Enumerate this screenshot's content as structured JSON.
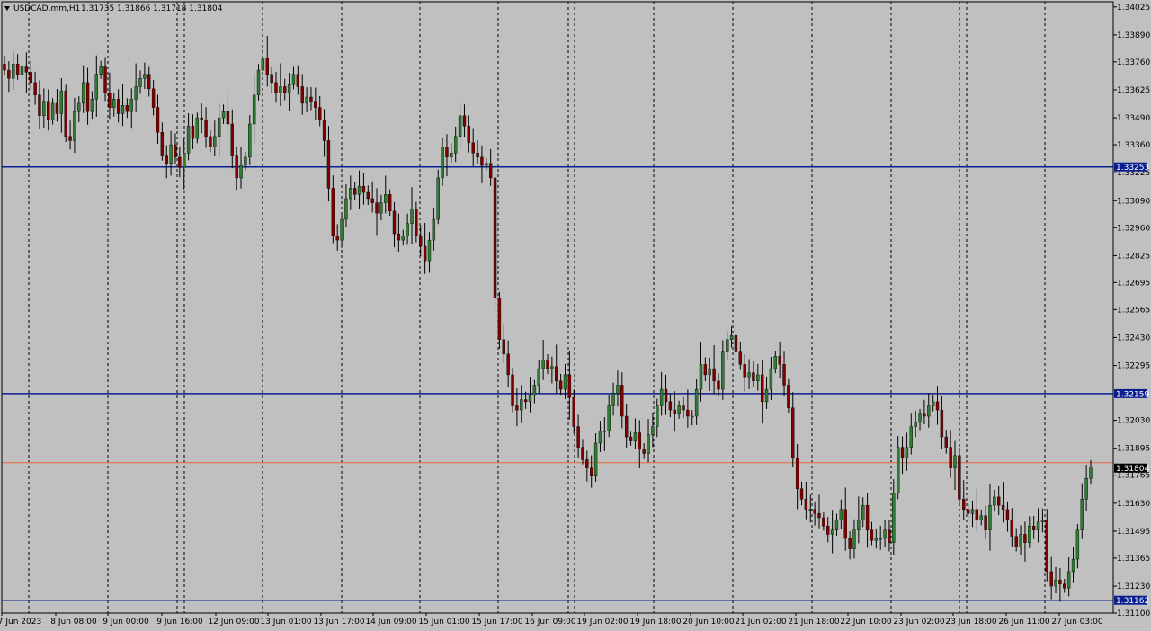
{
  "window": {
    "symbol_timeframe": "USDCAD.mm,H1",
    "ohlc_readout": "1.31735 1.31866 1.31718 1.31804",
    "menu_icon": "triangle-down-icon"
  },
  "colors": {
    "background": "#c0c0c0",
    "bull_body": "#2e7d32",
    "bear_body": "#800000",
    "wick": "#000000",
    "hline": "#0a1f8f",
    "bid_line": "#e8643c",
    "price_tag": "#000000",
    "level_tag": "#0a1f8f"
  },
  "chart_data": {
    "type": "candlestick",
    "title": "USDCAD.mm,H1",
    "ylim": [
      1.311,
      1.3405
    ],
    "y_ticks": [
      "1.34025",
      "1.33890",
      "1.33760",
      "1.33625",
      "1.33490",
      "1.33360",
      "1.33225",
      "1.33090",
      "1.32960",
      "1.32825",
      "1.32695",
      "1.32565",
      "1.32430",
      "1.32295",
      "1.32030",
      "1.31895",
      "1.31765",
      "1.31630",
      "1.31495",
      "1.31365",
      "1.31230",
      "1.31100"
    ],
    "x_ticks": [
      "7 Jun 2023",
      "8 Jun 08:00",
      "9 Jun 00:00",
      "9 Jun 16:00",
      "12 Jun 09:00",
      "13 Jun 01:00",
      "13 Jun 17:00",
      "14 Jun 09:00",
      "15 Jun 01:00",
      "15 Jun 17:00",
      "16 Jun 09:00",
      "19 Jun 02:00",
      "19 Jun 18:00",
      "20 Jun 10:00",
      "21 Jun 02:00",
      "21 Jun 18:00",
      "22 Jun 10:00",
      "23 Jun 02:00",
      "23 Jun 18:00",
      "26 Jun 11:00",
      "27 Jun 03:00"
    ],
    "horizontal_lines": [
      {
        "price": 1.33253,
        "label": "1.33253"
      },
      {
        "price": 1.32159,
        "label": "1.32159"
      },
      {
        "price": 1.31162,
        "label": "1.31162"
      }
    ],
    "bid": {
      "price": 1.31804,
      "label": "1.31804"
    },
    "closes": [
      1.3372,
      1.3368,
      1.3375,
      1.337,
      1.3374,
      1.3371,
      1.3366,
      1.336,
      1.335,
      1.3357,
      1.3348,
      1.3356,
      1.3351,
      1.3362,
      1.334,
      1.3338,
      1.3352,
      1.3356,
      1.3366,
      1.3352,
      1.3358,
      1.337,
      1.3374,
      1.3361,
      1.3354,
      1.3358,
      1.3351,
      1.3355,
      1.3352,
      1.3358,
      1.3364,
      1.3368,
      1.337,
      1.3363,
      1.3354,
      1.3342,
      1.3331,
      1.3327,
      1.3336,
      1.333,
      1.3325,
      1.3332,
      1.3345,
      1.3339,
      1.3349,
      1.3348,
      1.334,
      1.3335,
      1.334,
      1.3349,
      1.3352,
      1.3346,
      1.3331,
      1.332,
      1.3326,
      1.333,
      1.3346,
      1.336,
      1.3372,
      1.3378,
      1.337,
      1.3366,
      1.3361,
      1.3364,
      1.3361,
      1.3365,
      1.337,
      1.3364,
      1.3356,
      1.3359,
      1.3357,
      1.3354,
      1.3348,
      1.3338,
      1.3315,
      1.3292,
      1.329,
      1.33,
      1.331,
      1.3315,
      1.3312,
      1.3316,
      1.3313,
      1.331,
      1.3308,
      1.3303,
      1.3308,
      1.3312,
      1.3304,
      1.3293,
      1.329,
      1.3292,
      1.3298,
      1.3305,
      1.3292,
      1.3287,
      1.328,
      1.329,
      1.33,
      1.332,
      1.3335,
      1.333,
      1.3332,
      1.334,
      1.335,
      1.3345,
      1.3337,
      1.3332,
      1.333,
      1.3326,
      1.3327,
      1.332,
      1.3262,
      1.3242,
      1.3235,
      1.3225,
      1.321,
      1.3208,
      1.3213,
      1.3212,
      1.3215,
      1.322,
      1.3228,
      1.3232,
      1.3228,
      1.3229,
      1.3222,
      1.3218,
      1.3225,
      1.3214,
      1.32,
      1.319,
      1.3184,
      1.318,
      1.3176,
      1.3192,
      1.3198,
      1.3198,
      1.321,
      1.3216,
      1.322,
      1.3205,
      1.3195,
      1.3193,
      1.3197,
      1.3189,
      1.3187,
      1.3196,
      1.32,
      1.321,
      1.3218,
      1.3212,
      1.3208,
      1.3206,
      1.321,
      1.3208,
      1.3205,
      1.3205,
      1.3218,
      1.323,
      1.3225,
      1.3228,
      1.3222,
      1.3218,
      1.3236,
      1.3242,
      1.3244,
      1.3236,
      1.323,
      1.3224,
      1.3226,
      1.3222,
      1.3225,
      1.3212,
      1.3218,
      1.3228,
      1.3234,
      1.323,
      1.322,
      1.3209,
      1.3185,
      1.317,
      1.3165,
      1.316,
      1.316,
      1.3158,
      1.3156,
      1.3152,
      1.3148,
      1.315,
      1.3155,
      1.316,
      1.3146,
      1.3141,
      1.315,
      1.3155,
      1.3162,
      1.315,
      1.3145,
      1.3146,
      1.3146,
      1.315,
      1.3144,
      1.3168,
      1.319,
      1.3185,
      1.319,
      1.32,
      1.3202,
      1.3206,
      1.3205,
      1.321,
      1.3212,
      1.3208,
      1.3195,
      1.319,
      1.318,
      1.3186,
      1.3165,
      1.316,
      1.3158,
      1.316,
      1.3155,
      1.3157,
      1.315,
      1.3162,
      1.3166,
      1.3162,
      1.316,
      1.3155,
      1.3147,
      1.3142,
      1.3148,
      1.3144,
      1.3152,
      1.315,
      1.3154,
      1.3155,
      1.313,
      1.3123,
      1.3126,
      1.3124,
      1.3122,
      1.313,
      1.3136,
      1.315,
      1.3165,
      1.3175,
      1.31804
    ]
  }
}
